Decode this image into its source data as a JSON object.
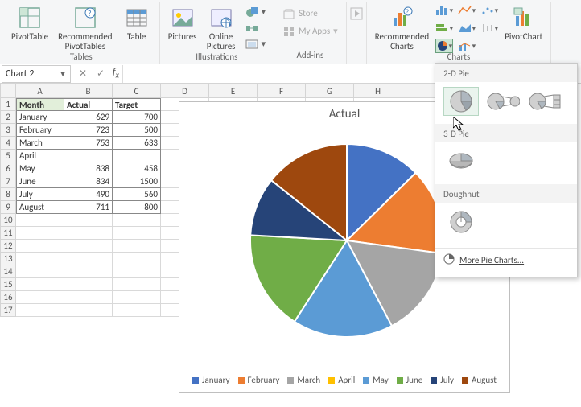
{
  "ribbon": {
    "groups": {
      "tables": {
        "label": "Tables",
        "pivottable": "PivotTable",
        "recommended": "Recommended\nPivotTables",
        "table": "Table"
      },
      "illustrations": {
        "label": "Illustrations",
        "pictures": "Pictures",
        "online": "Online\nPictures"
      },
      "addins": {
        "label": "Add-ins",
        "store": "Store",
        "myapps": "My Apps"
      },
      "charts": {
        "label": "Charts",
        "recommended": "Recommended\nCharts",
        "pivotchart": "PivotChart"
      }
    }
  },
  "namebox": "Chart 2",
  "grid": {
    "columns": [
      "A",
      "B",
      "C",
      "D",
      "E",
      "F",
      "G",
      "H",
      "I"
    ],
    "headers": {
      "month": "Month",
      "actual": "Actual",
      "target": "Target"
    },
    "rows": [
      {
        "m": "January",
        "a": 629,
        "t": 700
      },
      {
        "m": "February",
        "a": 723,
        "t": 500
      },
      {
        "m": "March",
        "a": 753,
        "t": 633
      },
      {
        "m": "April",
        "a": "",
        "t": ""
      },
      {
        "m": "May",
        "a": 838,
        "t": 458
      },
      {
        "m": "June",
        "a": 834,
        "t": 1500
      },
      {
        "m": "July",
        "a": 490,
        "t": 560
      },
      {
        "m": "August",
        "a": 711,
        "t": 800
      }
    ],
    "rowcount": 17
  },
  "chart": {
    "title": "Actual"
  },
  "pie_panel": {
    "sec2d": "2-D Pie",
    "sec3d": "3-D Pie",
    "secDoughnut": "Doughnut",
    "more": "More Pie Charts..."
  },
  "chart_data": {
    "type": "pie",
    "title": "Actual",
    "categories": [
      "January",
      "February",
      "March",
      "April",
      "May",
      "June",
      "July",
      "August"
    ],
    "values": [
      629,
      723,
      753,
      0,
      838,
      834,
      490,
      711
    ],
    "colors": [
      "#4472c4",
      "#ed7d31",
      "#a5a5a5",
      "#ffc000",
      "#5b9bd5",
      "#70ad47",
      "#264478",
      "#9e480e"
    ],
    "legend_position": "bottom"
  }
}
